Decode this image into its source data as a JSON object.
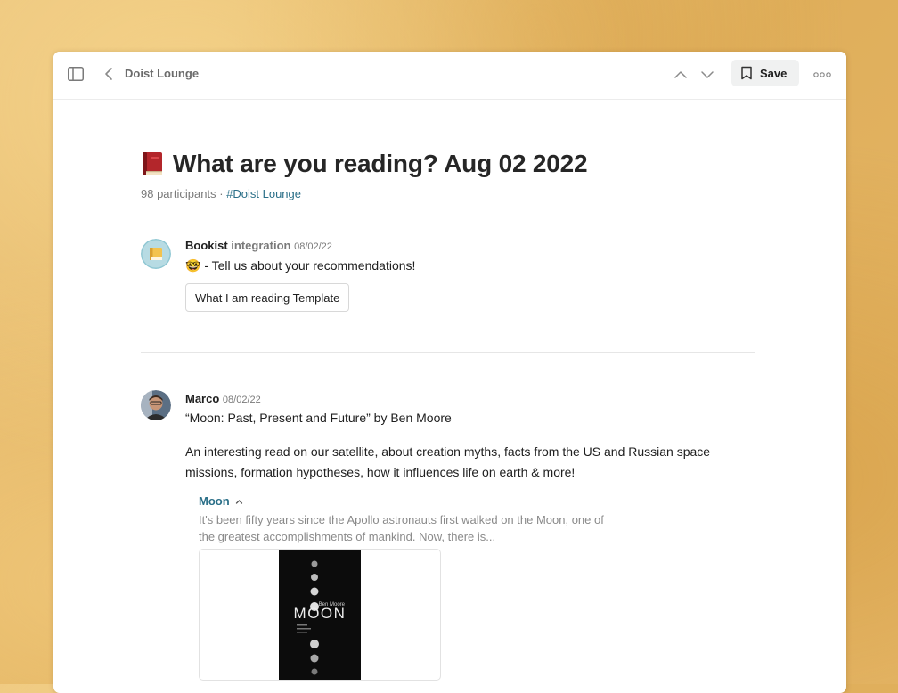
{
  "topbar": {
    "breadcrumb": "Doist Lounge",
    "save_label": "Save"
  },
  "thread": {
    "title": "What are you reading? Aug 02 2022",
    "participants": "98 participants",
    "separator": "·",
    "channel_link": "#Doist Lounge"
  },
  "posts": [
    {
      "author": "Bookist",
      "tag": "integration",
      "date": "08/02/22",
      "body": "🤓 - Tell us about your recommendations!",
      "button_label": "What I am reading Template"
    },
    {
      "author": "Marco",
      "date": "08/02/22",
      "line1": "“Moon: Past, Present and Future” by Ben Moore",
      "line2": "An interesting read on our satellite, about creation myths, facts from the US and Russian space missions, formation hypotheses, how it influences life on earth & more!",
      "attachment": {
        "title": "Moon",
        "description": "It's been fifty years since the Apollo astronauts first walked on the Moon, one of the greatest accomplishments of mankind. Now, there is...",
        "cover_author": "Ben Moore",
        "cover_title": "MOON"
      }
    }
  ],
  "colors": {
    "link": "#2a6f88",
    "background": "#e2b35f"
  }
}
